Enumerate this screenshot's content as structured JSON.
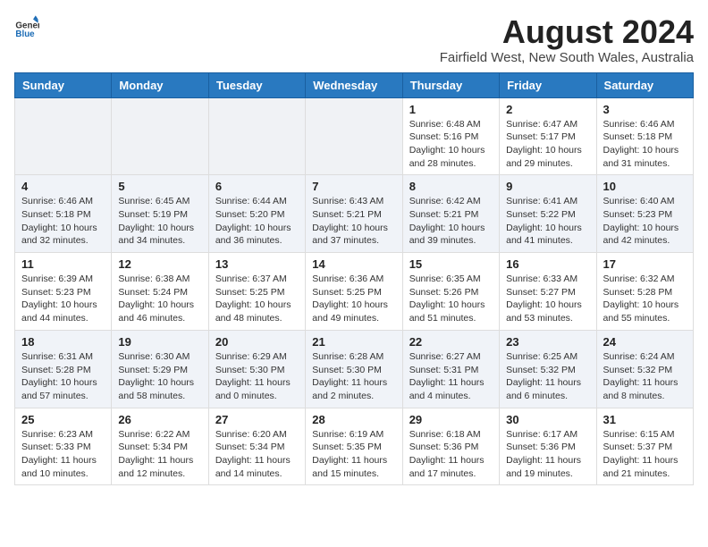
{
  "header": {
    "logo_general": "General",
    "logo_blue": "Blue",
    "title": "August 2024",
    "subtitle": "Fairfield West, New South Wales, Australia"
  },
  "days_of_week": [
    "Sunday",
    "Monday",
    "Tuesday",
    "Wednesday",
    "Thursday",
    "Friday",
    "Saturday"
  ],
  "weeks": [
    [
      {
        "day": "",
        "info": ""
      },
      {
        "day": "",
        "info": ""
      },
      {
        "day": "",
        "info": ""
      },
      {
        "day": "",
        "info": ""
      },
      {
        "day": "1",
        "info": "Sunrise: 6:48 AM\nSunset: 5:16 PM\nDaylight: 10 hours\nand 28 minutes."
      },
      {
        "day": "2",
        "info": "Sunrise: 6:47 AM\nSunset: 5:17 PM\nDaylight: 10 hours\nand 29 minutes."
      },
      {
        "day": "3",
        "info": "Sunrise: 6:46 AM\nSunset: 5:18 PM\nDaylight: 10 hours\nand 31 minutes."
      }
    ],
    [
      {
        "day": "4",
        "info": "Sunrise: 6:46 AM\nSunset: 5:18 PM\nDaylight: 10 hours\nand 32 minutes."
      },
      {
        "day": "5",
        "info": "Sunrise: 6:45 AM\nSunset: 5:19 PM\nDaylight: 10 hours\nand 34 minutes."
      },
      {
        "day": "6",
        "info": "Sunrise: 6:44 AM\nSunset: 5:20 PM\nDaylight: 10 hours\nand 36 minutes."
      },
      {
        "day": "7",
        "info": "Sunrise: 6:43 AM\nSunset: 5:21 PM\nDaylight: 10 hours\nand 37 minutes."
      },
      {
        "day": "8",
        "info": "Sunrise: 6:42 AM\nSunset: 5:21 PM\nDaylight: 10 hours\nand 39 minutes."
      },
      {
        "day": "9",
        "info": "Sunrise: 6:41 AM\nSunset: 5:22 PM\nDaylight: 10 hours\nand 41 minutes."
      },
      {
        "day": "10",
        "info": "Sunrise: 6:40 AM\nSunset: 5:23 PM\nDaylight: 10 hours\nand 42 minutes."
      }
    ],
    [
      {
        "day": "11",
        "info": "Sunrise: 6:39 AM\nSunset: 5:23 PM\nDaylight: 10 hours\nand 44 minutes."
      },
      {
        "day": "12",
        "info": "Sunrise: 6:38 AM\nSunset: 5:24 PM\nDaylight: 10 hours\nand 46 minutes."
      },
      {
        "day": "13",
        "info": "Sunrise: 6:37 AM\nSunset: 5:25 PM\nDaylight: 10 hours\nand 48 minutes."
      },
      {
        "day": "14",
        "info": "Sunrise: 6:36 AM\nSunset: 5:25 PM\nDaylight: 10 hours\nand 49 minutes."
      },
      {
        "day": "15",
        "info": "Sunrise: 6:35 AM\nSunset: 5:26 PM\nDaylight: 10 hours\nand 51 minutes."
      },
      {
        "day": "16",
        "info": "Sunrise: 6:33 AM\nSunset: 5:27 PM\nDaylight: 10 hours\nand 53 minutes."
      },
      {
        "day": "17",
        "info": "Sunrise: 6:32 AM\nSunset: 5:28 PM\nDaylight: 10 hours\nand 55 minutes."
      }
    ],
    [
      {
        "day": "18",
        "info": "Sunrise: 6:31 AM\nSunset: 5:28 PM\nDaylight: 10 hours\nand 57 minutes."
      },
      {
        "day": "19",
        "info": "Sunrise: 6:30 AM\nSunset: 5:29 PM\nDaylight: 10 hours\nand 58 minutes."
      },
      {
        "day": "20",
        "info": "Sunrise: 6:29 AM\nSunset: 5:30 PM\nDaylight: 11 hours\nand 0 minutes."
      },
      {
        "day": "21",
        "info": "Sunrise: 6:28 AM\nSunset: 5:30 PM\nDaylight: 11 hours\nand 2 minutes."
      },
      {
        "day": "22",
        "info": "Sunrise: 6:27 AM\nSunset: 5:31 PM\nDaylight: 11 hours\nand 4 minutes."
      },
      {
        "day": "23",
        "info": "Sunrise: 6:25 AM\nSunset: 5:32 PM\nDaylight: 11 hours\nand 6 minutes."
      },
      {
        "day": "24",
        "info": "Sunrise: 6:24 AM\nSunset: 5:32 PM\nDaylight: 11 hours\nand 8 minutes."
      }
    ],
    [
      {
        "day": "25",
        "info": "Sunrise: 6:23 AM\nSunset: 5:33 PM\nDaylight: 11 hours\nand 10 minutes."
      },
      {
        "day": "26",
        "info": "Sunrise: 6:22 AM\nSunset: 5:34 PM\nDaylight: 11 hours\nand 12 minutes."
      },
      {
        "day": "27",
        "info": "Sunrise: 6:20 AM\nSunset: 5:34 PM\nDaylight: 11 hours\nand 14 minutes."
      },
      {
        "day": "28",
        "info": "Sunrise: 6:19 AM\nSunset: 5:35 PM\nDaylight: 11 hours\nand 15 minutes."
      },
      {
        "day": "29",
        "info": "Sunrise: 6:18 AM\nSunset: 5:36 PM\nDaylight: 11 hours\nand 17 minutes."
      },
      {
        "day": "30",
        "info": "Sunrise: 6:17 AM\nSunset: 5:36 PM\nDaylight: 11 hours\nand 19 minutes."
      },
      {
        "day": "31",
        "info": "Sunrise: 6:15 AM\nSunset: 5:37 PM\nDaylight: 11 hours\nand 21 minutes."
      }
    ]
  ]
}
